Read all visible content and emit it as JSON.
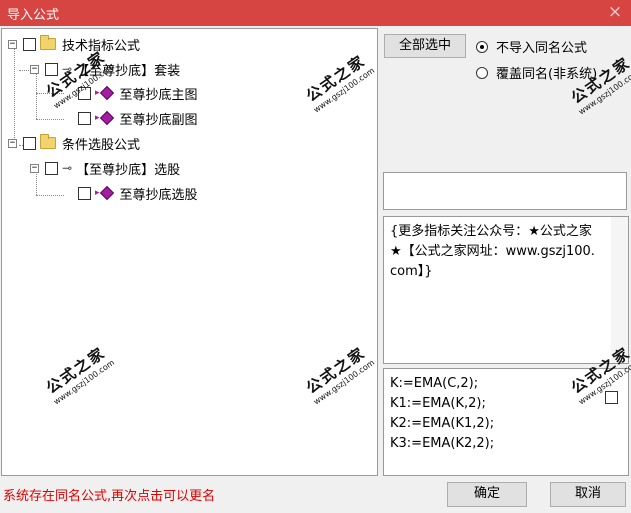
{
  "window": {
    "title": "导入公式",
    "close_glyph": "×"
  },
  "tree": {
    "items": [
      {
        "label": "技术指标公式",
        "icon": "folder-icon",
        "expander": "−"
      },
      {
        "label": "【至尊抄底】套装",
        "icon": "key-icon",
        "expander": "−"
      },
      {
        "label": "至尊抄底主图",
        "icon": "gem-icon"
      },
      {
        "label": "至尊抄底副图",
        "icon": "gem-icon"
      },
      {
        "label": "条件选股公式",
        "icon": "folder-icon",
        "expander": "−"
      },
      {
        "label": "【至尊抄底】选股",
        "icon": "key-icon",
        "expander": "−"
      },
      {
        "label": "至尊抄底选股",
        "icon": "gem-icon"
      }
    ]
  },
  "options": {
    "select_all_label": "全部选中",
    "radio_skip_label": "不导入同名公式",
    "radio_overwrite_label": "覆盖同名(非系统)",
    "selected": "skip"
  },
  "description": {
    "text": "{更多指标关注公众号：★公式之家★【公式之家网址：www.gszj100.com】}"
  },
  "code": {
    "lines": [
      "K:=EMA(C,2);",
      "K1:=EMA(K,2);",
      "K2:=EMA(K1,2);",
      "K3:=EMA(K2,2);"
    ]
  },
  "watermark": {
    "main": "公式之家",
    "sub": "www.gszj100.com"
  },
  "status": {
    "message": "系统存在同名公式,再次点击可以更名",
    "color": "#e00000"
  },
  "buttons": {
    "ok_label": "确定",
    "cancel_label": "取消"
  },
  "colors": {
    "titlebar": "#d64541",
    "gem": "#a020a0",
    "folder": "#f3d36b"
  }
}
